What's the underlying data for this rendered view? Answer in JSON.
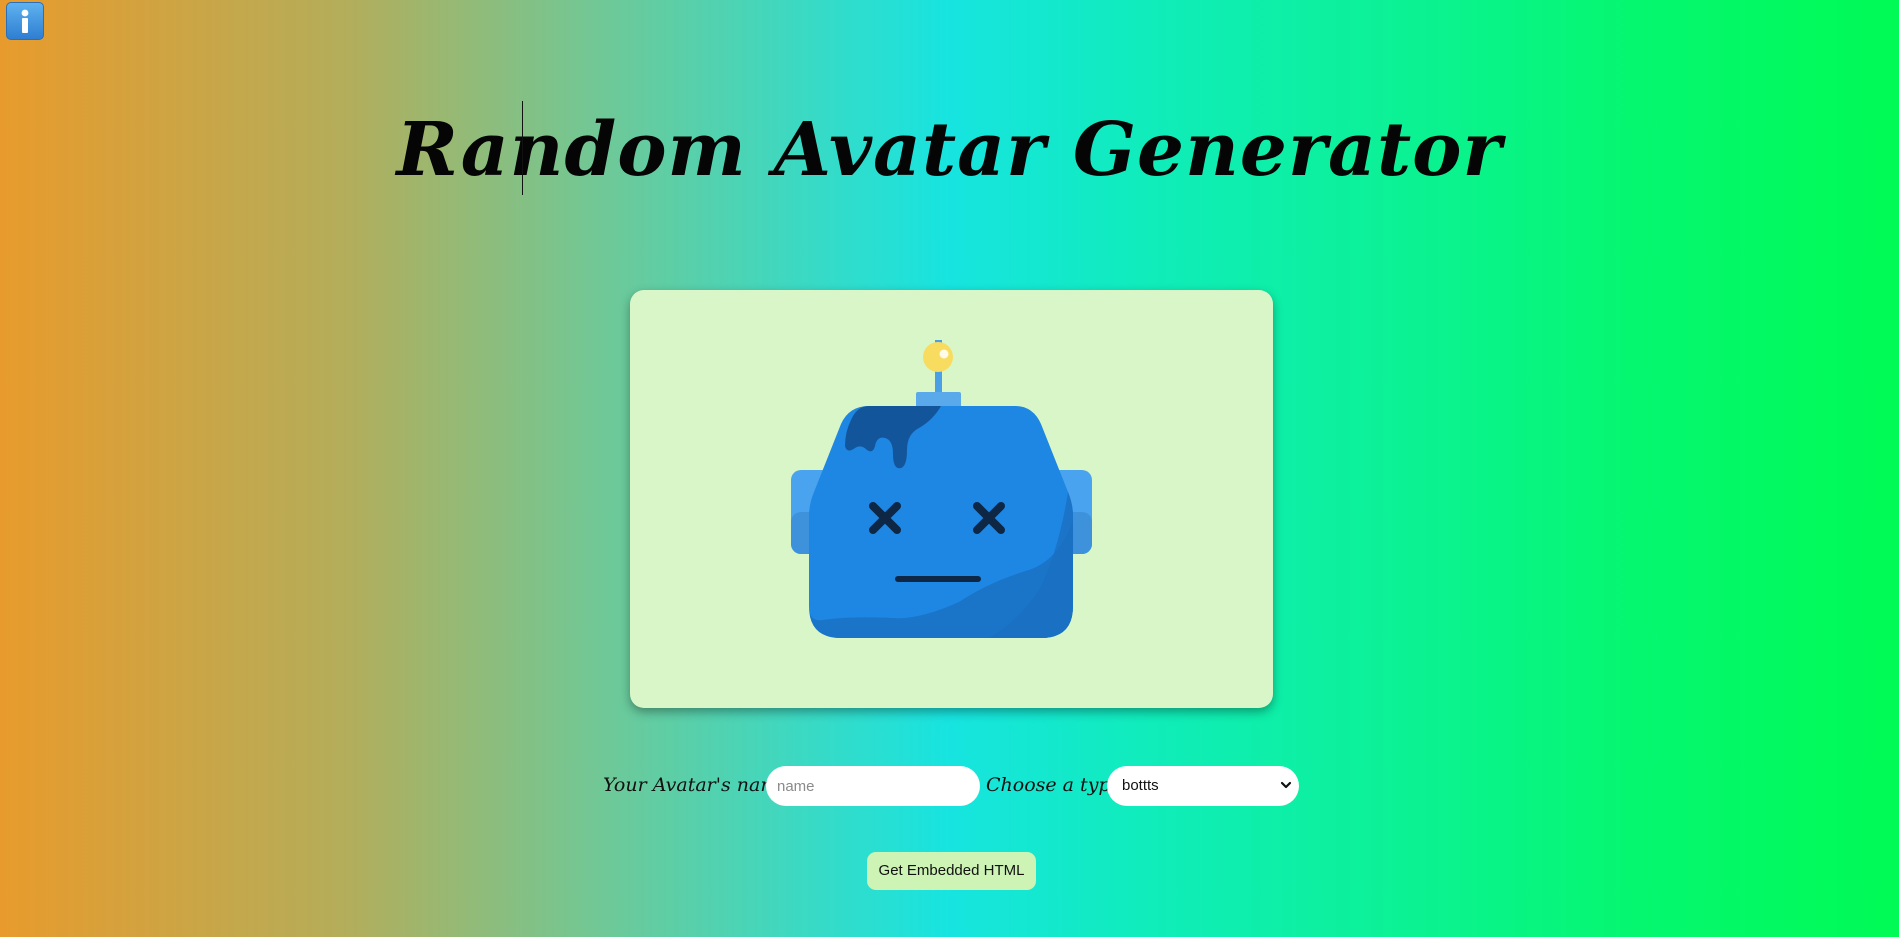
{
  "header": {
    "info_icon": "info-icon",
    "title": "Random Avatar Generator"
  },
  "avatar": {
    "style": "bottts",
    "card_background": "#d9f6c9",
    "icon": "robot-avatar"
  },
  "form": {
    "name_label": "Your Avatar's name",
    "name_placeholder": "name",
    "name_value": "",
    "type_label": "Choose a type:",
    "type_selected": "bottts"
  },
  "actions": {
    "embed_label": "Get Embedded HTML"
  },
  "colors": {
    "gradient_left": "#e89b2c",
    "gradient_middle": "#17e4e0",
    "gradient_right": "#00fb55",
    "button_background": "#cdf3b5"
  }
}
